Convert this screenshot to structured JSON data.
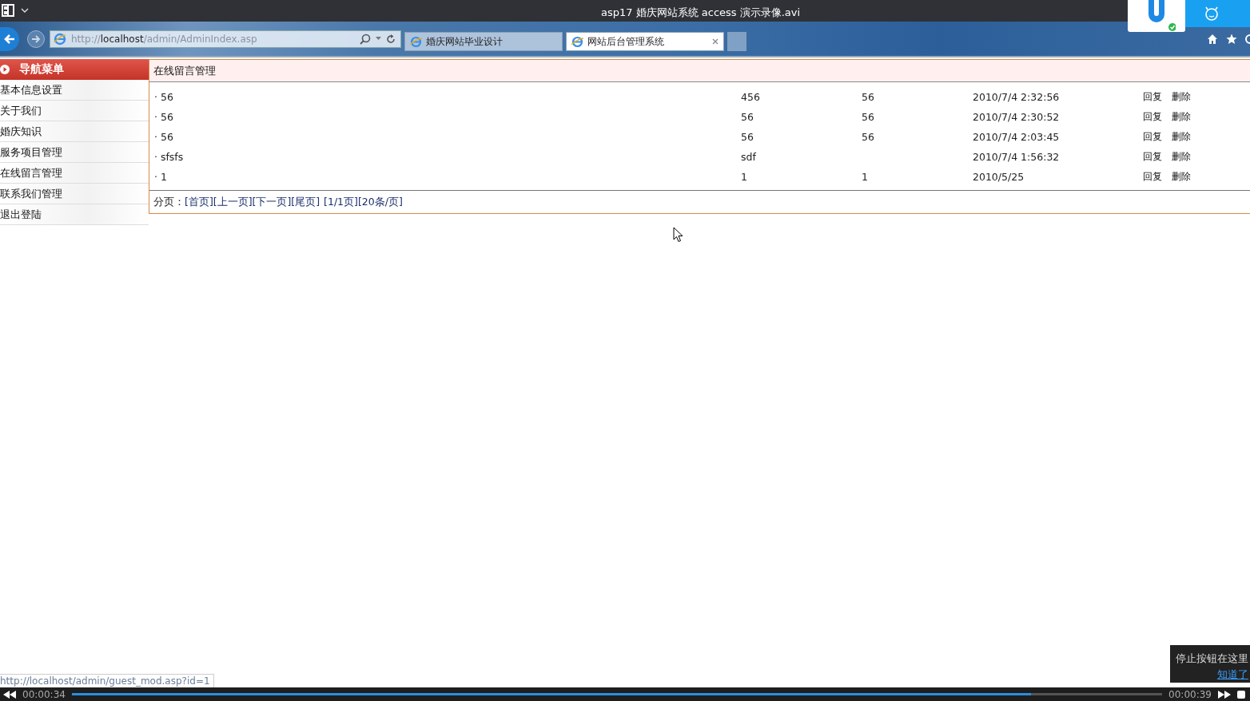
{
  "player": {
    "title": "asp17 婚庆网站系统 access 演示录像.avi",
    "elapsed": "00:00:34",
    "total": "00:00:39",
    "progress": {
      "level": 0.88
    },
    "hint": {
      "text": "停止按钮在这里",
      "link": "知道了"
    }
  },
  "browser": {
    "address": "http://**localhost**/admin/AdminIndex.asp",
    "tabs": [
      {
        "label": "婚庆网站毕业设计",
        "selected": false
      },
      {
        "label": "网站后台管理系统",
        "selected": true
      }
    ],
    "status_url": "http://localhost/admin/guest_mod.asp?id=1"
  },
  "sidebar": {
    "title": "导航菜单",
    "items": [
      "基本信息设置",
      "关于我们",
      "婚庆知识",
      "服务项目管理",
      "在线留言管理",
      "联系我们管理",
      "退出登陆"
    ]
  },
  "panel": {
    "title": "在线留言管理",
    "rows": [
      {
        "title": "· 56",
        "column_2": "456",
        "column_3": "56",
        "date": "2010/7/4 2:32:56",
        "actions": [
          "回复",
          "删除"
        ]
      },
      {
        "title": "· 56",
        "column_2": "56",
        "column_3": "56",
        "date": "2010/7/4 2:30:52",
        "actions": [
          "回复",
          "删除"
        ]
      },
      {
        "title": "· 56",
        "column_2": "56",
        "column_3": "56",
        "date": "2010/7/4 2:03:45",
        "actions": [
          "回复",
          "删除"
        ]
      },
      {
        "title": "· sfsfs",
        "column_2": "sdf",
        "date": "2010/7/4 1:56:32",
        "actions": [
          "回复",
          "删除"
        ]
      },
      {
        "title": "· 1",
        "column_2": "1",
        "column_3": "1",
        "date": "2010/5/25",
        "actions": [
          "回复",
          "删除"
        ]
      }
    ],
    "pager": {
      "label": "分页：",
      "links": [
        "[首页]",
        "[上一页]",
        "[下一页]",
        "[尾页]"
      ],
      "info": [
        "[1/1页]",
        "[20条/页]"
      ]
    }
  }
}
